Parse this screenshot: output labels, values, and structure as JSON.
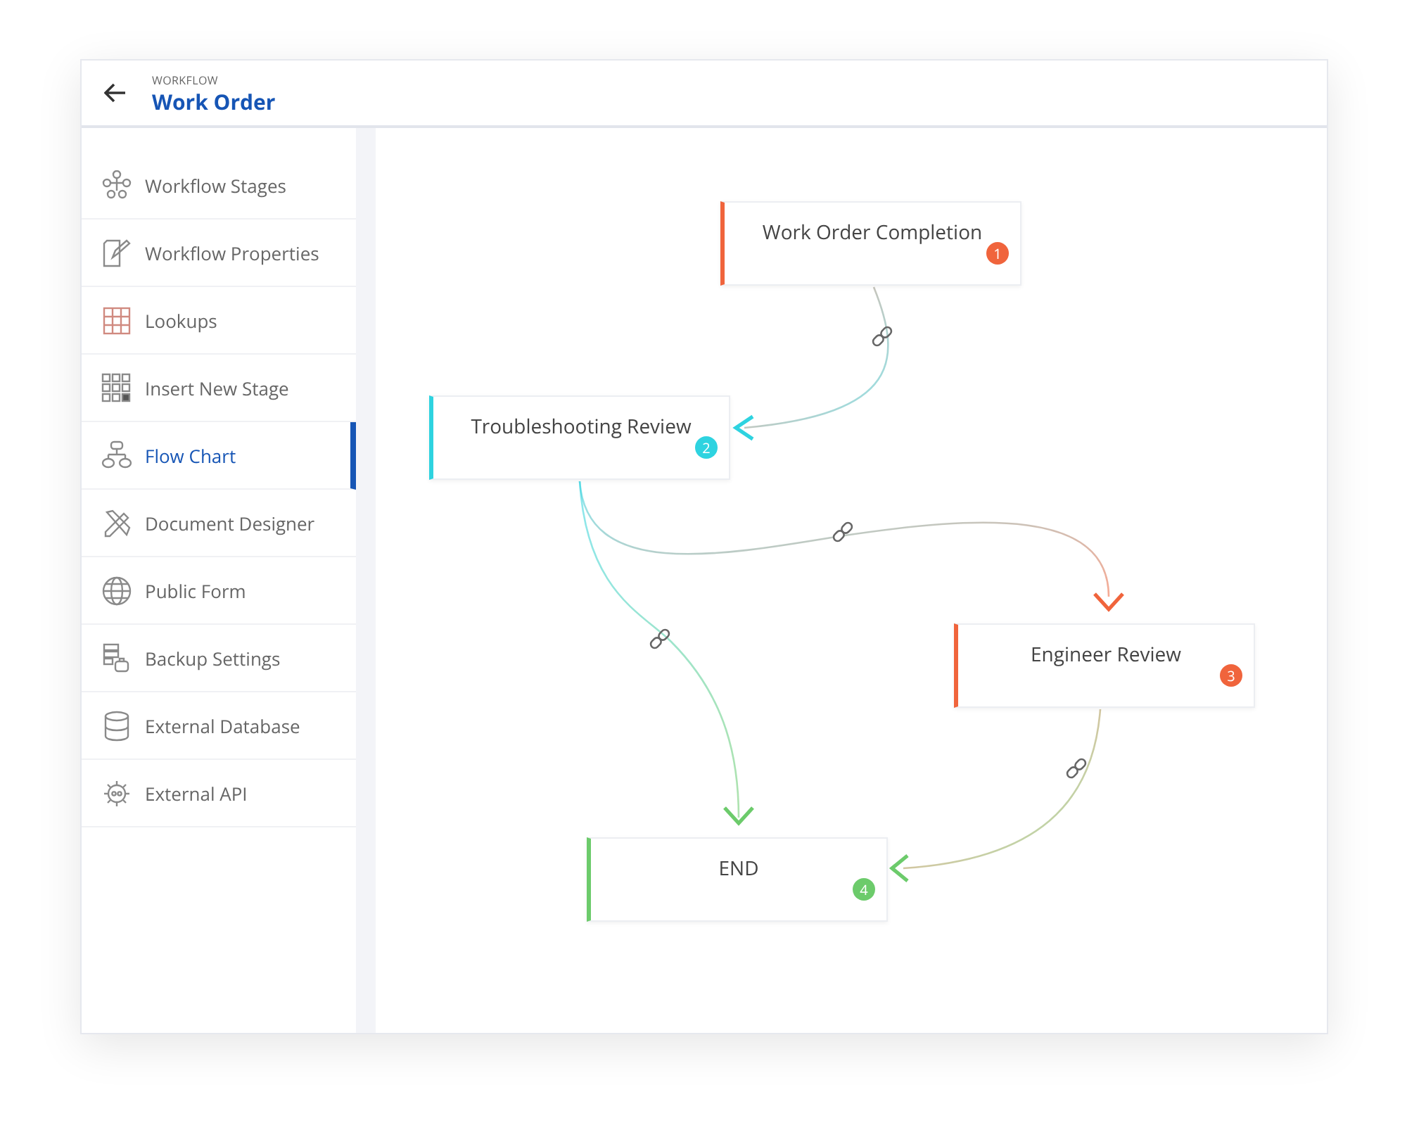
{
  "header": {
    "eyebrow": "WORKFLOW",
    "title": "Work Order"
  },
  "sidebar": {
    "items": [
      {
        "label": "Workflow Stages",
        "selected": false
      },
      {
        "label": "Workflow Properties",
        "selected": false
      },
      {
        "label": "Lookups",
        "selected": false
      },
      {
        "label": "Insert New Stage",
        "selected": false
      },
      {
        "label": "Flow Chart",
        "selected": true
      },
      {
        "label": "Document Designer",
        "selected": false
      },
      {
        "label": "Public Form",
        "selected": false
      },
      {
        "label": "Backup Settings",
        "selected": false
      },
      {
        "label": "External Database",
        "selected": false
      },
      {
        "label": "External API",
        "selected": false
      }
    ]
  },
  "flow_chart": {
    "nodes": [
      {
        "label": "Work Order Completion",
        "badge": "1",
        "color": "#f0643c"
      },
      {
        "label": "Troubleshooting Review",
        "badge": "2",
        "color": "#2ed3e0"
      },
      {
        "label": "Engineer Review",
        "badge": "3",
        "color": "#f0643c"
      },
      {
        "label": "END",
        "badge": "4",
        "color": "#6ccb6b"
      }
    ]
  }
}
